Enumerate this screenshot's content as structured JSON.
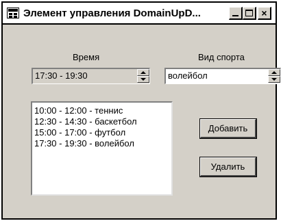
{
  "window": {
    "title": "Элемент управления DomainUpD..."
  },
  "time": {
    "label": "Время",
    "value": "17:30 - 19:30"
  },
  "sport": {
    "label": "Вид спорта",
    "value": "волейбол"
  },
  "schedule": {
    "items": [
      "10:00 - 12:00 - теннис",
      "12:30 - 14:30 - баскетбол",
      "15:00 - 17:00 - футбол",
      "17:30 - 19:30 - волейбол"
    ]
  },
  "buttons": {
    "add": "Добавить",
    "remove": "Удалить"
  },
  "titlebar_buttons": {
    "close_glyph": "×"
  }
}
